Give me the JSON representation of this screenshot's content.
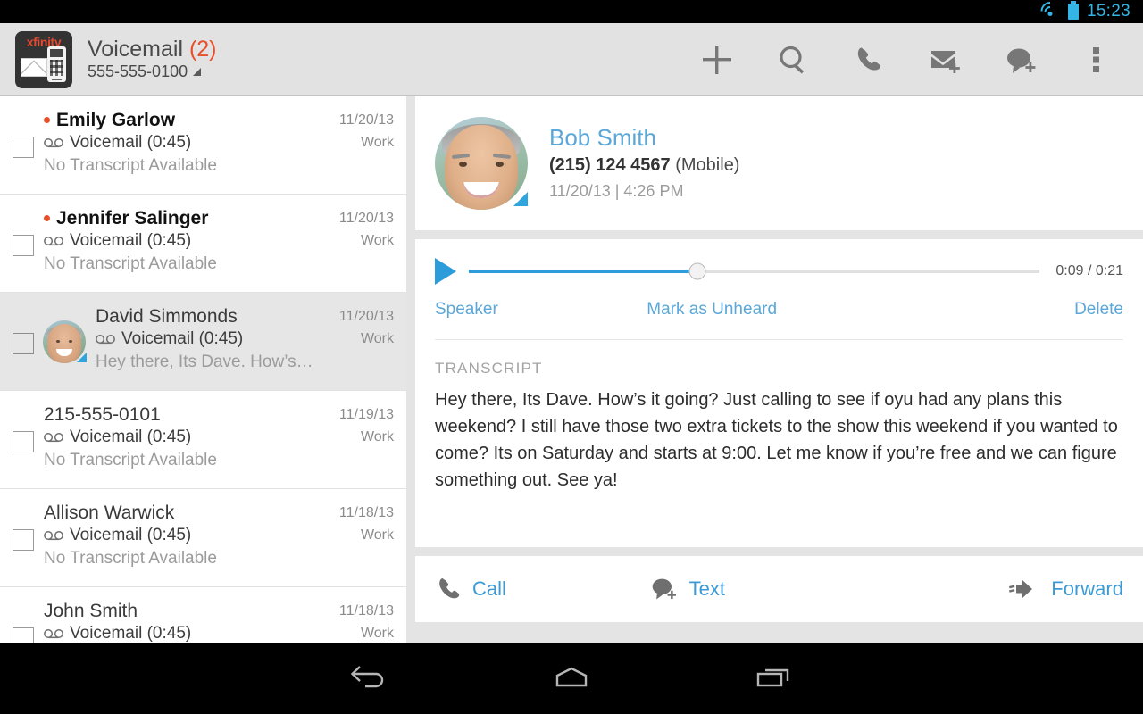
{
  "status_bar": {
    "time": "15:23",
    "wifi_icon": "wifi-icon",
    "battery_icon": "battery-icon",
    "accent_color": "#33b5e5"
  },
  "app_bar": {
    "logo_brand": "xfinity",
    "title": "Voicemail",
    "unread_count": "(2)",
    "phone_number": "555-555-0100",
    "unread_color": "#e8502a",
    "actions": [
      {
        "name": "add-icon",
        "label": "Add"
      },
      {
        "name": "search-icon",
        "label": "Search"
      },
      {
        "name": "phone-icon",
        "label": "Call"
      },
      {
        "name": "mail-add-icon",
        "label": "New Email"
      },
      {
        "name": "chat-add-icon",
        "label": "New Message"
      },
      {
        "name": "overflow-menu-icon",
        "label": "More options"
      }
    ]
  },
  "voicemail_list": [
    {
      "name": "Emily Garlow",
      "type": "Voicemail (0:45)",
      "preview": "No Transcript Available",
      "date": "11/20/13",
      "label": "Work",
      "unread": true,
      "selected": false,
      "has_avatar": false
    },
    {
      "name": "Jennifer Salinger",
      "type": "Voicemail (0:45)",
      "preview": "No Transcript Available",
      "date": "11/20/13",
      "label": "Work",
      "unread": true,
      "selected": false,
      "has_avatar": false
    },
    {
      "name": "David Simmonds",
      "type": "Voicemail (0:45)",
      "preview": "Hey there, Its Dave. How’s it going…",
      "date": "11/20/13",
      "label": "Work",
      "unread": false,
      "selected": true,
      "has_avatar": true
    },
    {
      "name": "215-555-0101",
      "type": "Voicemail (0:45)",
      "preview": "No Transcript Available",
      "date": "11/19/13",
      "label": "Work",
      "unread": false,
      "selected": false,
      "has_avatar": false
    },
    {
      "name": "Allison Warwick",
      "type": "Voicemail (0:45)",
      "preview": "No Transcript Available",
      "date": "11/18/13",
      "label": "Work",
      "unread": false,
      "selected": false,
      "has_avatar": false
    },
    {
      "name": "John Smith",
      "type": "Voicemail (0:45)",
      "preview": "",
      "date": "11/18/13",
      "label": "Work",
      "unread": false,
      "selected": false,
      "has_avatar": false
    }
  ],
  "detail": {
    "contact_name": "Bob Smith",
    "contact_name_color": "#5ba7d8",
    "phone_number": "(215) 124 4567",
    "phone_type": "(Mobile)",
    "timestamp": "11/20/13 | 4:26 PM",
    "player": {
      "current_time": "0:09",
      "total_time": "0:21",
      "time_display": "0:09 / 0:21",
      "progress_percent": 40,
      "play_icon": "play-icon",
      "speaker_label": "Speaker",
      "mark_unheard_label": "Mark as Unheard",
      "delete_label": "Delete"
    },
    "transcript_label": "TRANSCRIPT",
    "transcript_text": "Hey there, Its Dave. How’s it going? Just calling to see if oyu had any plans this weekend? I still have those two extra tickets to the show this weekend if you wanted to come? Its on Saturday and starts at 9:00. Let me know if you’re free and we can figure something out. See ya!",
    "actions": [
      {
        "label": "Call",
        "icon": "phone-icon"
      },
      {
        "label": "Text",
        "icon": "chat-add-icon"
      },
      {
        "label": "Forward",
        "icon": "forward-arrow-icon"
      }
    ]
  },
  "nav_bar": [
    {
      "name": "back-icon",
      "label": "Back"
    },
    {
      "name": "home-icon",
      "label": "Home"
    },
    {
      "name": "recents-icon",
      "label": "Recent apps"
    }
  ]
}
